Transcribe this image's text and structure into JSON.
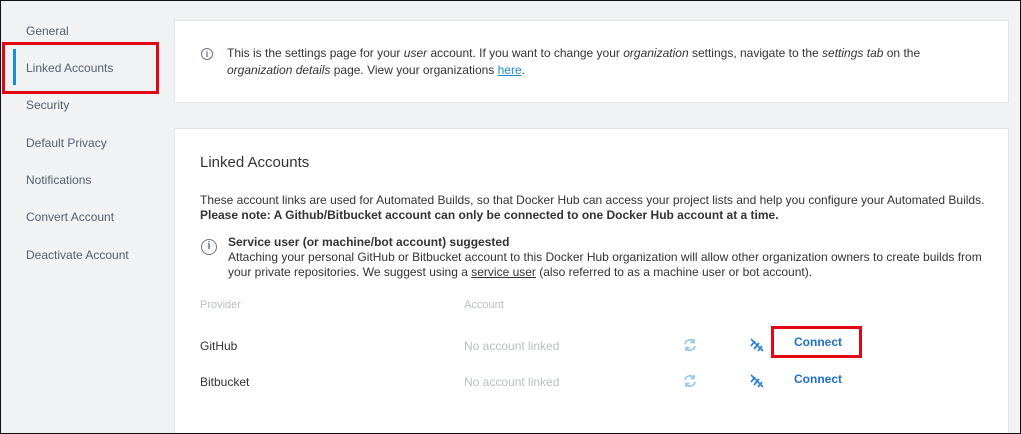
{
  "sidebar": {
    "items": [
      {
        "label": "General"
      },
      {
        "label": "Linked Accounts"
      },
      {
        "label": "Security"
      },
      {
        "label": "Default Privacy"
      },
      {
        "label": "Notifications"
      },
      {
        "label": "Convert Account"
      },
      {
        "label": "Deactivate Account"
      }
    ],
    "active": "Linked Accounts"
  },
  "info_banner": {
    "icon": "info-icon",
    "text_1": "This is the settings page for your ",
    "em_1": "user",
    "text_2": " account. If you want to change your ",
    "em_2": "organization",
    "text_3": " settings, navigate to the ",
    "em_3": "settings tab",
    "text_4": " on the ",
    "em_4": "organization details",
    "text_5": " page. View your organizations ",
    "link": "here",
    "text_6": "."
  },
  "linked_accounts": {
    "title": "Linked Accounts",
    "description": "These account links are used for Automated Builds, so that Docker Hub can access your project lists and help you configure your Automated Builds. ",
    "note": "Please note: A Github/Bitbucket account can only be connected to one Docker Hub account at a time.",
    "service_user": {
      "title": "Service user (or machine/bot account) suggested",
      "text_1": "Attaching your personal GitHub or Bitbucket account to this Docker Hub organization will allow other organization owners to create builds from your private repositories. We suggest using a ",
      "link": "service user",
      "text_2": " (also referred to as a machine user or bot account)."
    },
    "columns": {
      "provider": "Provider",
      "account": "Account"
    },
    "rows": [
      {
        "provider": "GitHub",
        "account": "No account linked",
        "action": "Connect"
      },
      {
        "provider": "Bitbucket",
        "account": "No account linked",
        "action": "Connect"
      }
    ]
  },
  "colors": {
    "accent": "#1d8bd8",
    "highlight": "#e30613",
    "connect": "#1d6fd0"
  }
}
